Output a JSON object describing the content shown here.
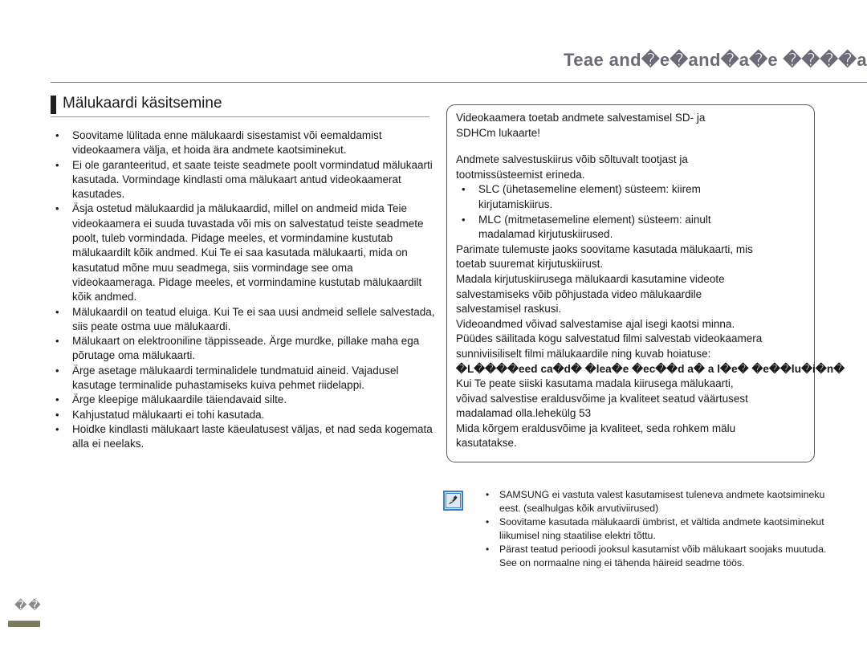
{
  "header": {
    "title": "Teae and�e�and�a�e ����a"
  },
  "section": {
    "title": "Mälukaardi käsitsemine"
  },
  "left_bullets": [
    "Soovitame lülitada enne mälukaardi sisestamist või eemaldamist videokaamera välja, et hoida ära andmete kaotsiminekut.",
    "Ei ole garanteeritud, et saate teiste seadmete poolt vormindatud mälukaarti kasutada. Vormindage kindlasti oma mälukaart antud videokaamerat kasutades.",
    "Äsja ostetud mälukaardid ja mälukaardid, millel on andmeid mida Teie videokaamera ei suuda tuvastada või mis on salvestatud teiste seadmete poolt, tuleb vormindada. Pidage meeles, et vormindamine kustutab mälukaardilt kõik andmed. Kui Te ei saa kasutada mälukaarti, mida on kasutatud mõne muu seadmega, siis vormindage see oma videokaameraga. Pidage meeles, et vormindamine kustutab mälukaardilt kõik andmed.",
    "Mälukaardil on teatud eluiga. Kui Te ei saa uusi andmeid sellele salvestada, siis peate ostma uue mälukaardi.",
    "Mälukaart on elektrooniline täppisseade. Ärge murdke, pillake maha ega põrutage oma mälukaarti.",
    "Ärge asetage mälukaardi terminalidele tundmatuid aineid. Vajadusel kasutage terminalide puhastamiseks kuiva pehmet riidelappi.",
    "Ärge kleepige mälukaardile täiendavaid silte.",
    "Kahjustatud mälukaarti ei tohi kasutada.",
    "Hoidke kindlasti mälukaart laste käeulatusest väljas, et nad seda kogemata alla ei neelaks."
  ],
  "panel": {
    "intro_line1": "Videokaamera toetab andmete salvestamisel SD- ja",
    "intro_line2": "SDHCm lukaarte!",
    "speed_line1": "Andmete salvestuskiirus võib sõltuvalt tootjast ja",
    "speed_line2": "tootmissüsteemist erineda.",
    "bullet_slc_line1": "SLC (ühetasemeline element) süsteem: kiirem",
    "bullet_slc_line2": "kirjutamiskiirus.",
    "bullet_mlc_line1": "MLC (mitmetasemeline element) süsteem: ainult",
    "bullet_mlc_line2": "madalamad kirjutuskiirused.",
    "best_line1": "Parimate tulemuste jaoks soovitame kasutada mälukaarti, mis",
    "best_line2": "toetab suuremat kirjutuskiirust.",
    "slow_line1": "Madala kirjutuskiirusega mälukaardi kasutamine videote",
    "slow_line2": "salvestamiseks võib põhjustada video mälukaardile",
    "slow_line3": "salvestamisel raskusi.",
    "loss_line1": "Videoandmed võivad salvestamise ajal isegi kaotsi minna.",
    "loss_line2": "Püüdes säilitada kogu salvestatud filmi salvestab videokaamera",
    "loss_line3": "sunniviisiliselt filmi mälukaardile ning kuvab hoiatuse:",
    "warning_bold": "�L����eed ca�d� �lea�e �ec��d a�  a l�e� �e��lu�i�n�",
    "after_line1": "Kui Te peate siiski kasutama madala kiirusega mälukaarti,",
    "after_line2": "võivad salvestise eraldusvõime ja kvaliteet seatud väärtusest",
    "after_line3": "madalamad olla.lehekülg 53",
    "after_line4": "Mida kõrgem eraldusvõime ja kvaliteet, seda rohkem mälu",
    "after_line5": "kasutatakse."
  },
  "note": {
    "icon": "note-pen-icon",
    "items": [
      "SAMSUNG ei vastuta valest kasutamisest tuleneva andmete kaotsimineku eest. (sealhulgas kõik arvutiviirused)",
      "Soovitame kasutada mälukaardi ümbrist, et vältida andmete kaotsiminekut liikumisel ning staatilise elektri tõttu.",
      "Pärast teatud perioodi jooksul kasutamist võib mälukaart soojaks muutuda. See on normaalne ning ei tähenda häireid seadme töös."
    ]
  },
  "footer": {
    "page_marker": "��"
  },
  "colors": {
    "header_text": "#6b6b78",
    "body_text": "#1a1a1a",
    "title_bar": "#231f20",
    "panel_border": "#58585c",
    "note_icon_border": "#3f7fc6",
    "note_icon_fill": "#dce9f6",
    "page_bar": "#7d7b5e"
  }
}
